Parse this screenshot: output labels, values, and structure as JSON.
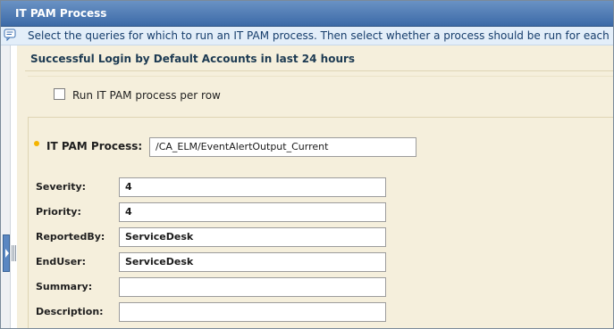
{
  "window": {
    "title": "IT PAM Process"
  },
  "info": {
    "icon": "speech-bubble-icon",
    "text": "Select the queries for which to run an IT PAM process. Then select whether a process should be run for each row."
  },
  "section": {
    "title": "Successful Login by Default Accounts in last 24 hours"
  },
  "options": {
    "run_per_row": {
      "label": "Run IT PAM process per row",
      "checked": false
    }
  },
  "form": {
    "pam_process": {
      "label": "IT PAM Process:",
      "value": "/CA_ELM/EventAlertOutput_Current",
      "required": true
    },
    "fields": [
      {
        "label": "Severity:",
        "value": "4"
      },
      {
        "label": "Priority:",
        "value": "4"
      },
      {
        "label": "ReportedBy:",
        "value": "ServiceDesk"
      },
      {
        "label": "EndUser:",
        "value": "ServiceDesk"
      },
      {
        "label": "Summary:",
        "value": ""
      },
      {
        "label": "Description:",
        "value": ""
      }
    ]
  },
  "colors": {
    "titlebar": "#3c6aa7",
    "panel": "#f5efdc",
    "info_bg": "#e3eef9",
    "required": "#f4b400"
  }
}
